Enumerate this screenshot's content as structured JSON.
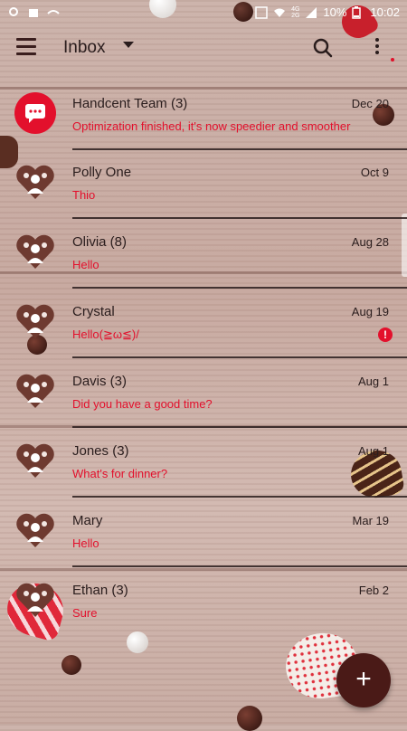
{
  "status_bar": {
    "battery": "10%",
    "time": "10:02",
    "network_top": "4G",
    "network_bottom": "2G"
  },
  "toolbar": {
    "title": "Inbox",
    "menu_icon": "hamburger-menu-icon",
    "dropdown_icon": "caret-down-icon",
    "search_icon": "search-icon",
    "more_icon": "more-vert-icon"
  },
  "conversations": [
    {
      "name": "Handcent Team (3)",
      "date": "Dec 20",
      "snippet": "Optimization finished, it's now speedier and smoother",
      "avatar": "chat-bubble-icon",
      "error": false
    },
    {
      "name": "Polly One",
      "date": "Oct 9",
      "snippet": "Thio",
      "avatar": "contact-heart-avatar",
      "error": false
    },
    {
      "name": "Olivia (8)",
      "date": "Aug 28",
      "snippet": "Hello",
      "avatar": "contact-heart-avatar",
      "error": false
    },
    {
      "name": "Crystal",
      "date": "Aug 19",
      "snippet": "Hello(≧ω≦)/",
      "avatar": "contact-heart-avatar",
      "error": true
    },
    {
      "name": "Davis (3)",
      "date": "Aug 1",
      "snippet": "Did you have a good time?",
      "avatar": "contact-heart-avatar",
      "error": false
    },
    {
      "name": "Jones (3)",
      "date": "Aug 1",
      "snippet": "What's for dinner?",
      "avatar": "contact-heart-avatar",
      "error": false
    },
    {
      "name": "Mary",
      "date": "Mar 19",
      "snippet": "Hello",
      "avatar": "contact-heart-avatar",
      "error": false
    },
    {
      "name": "Ethan (3)",
      "date": "Feb 2",
      "snippet": "Sure",
      "avatar": "contact-heart-avatar",
      "error": false
    }
  ],
  "error_badge": "!",
  "fab": {
    "label": "+",
    "icon": "compose-plus-icon"
  },
  "colors": {
    "accent": "#e3102c",
    "fab": "#4a1a17",
    "text": "#2a1d1d"
  }
}
